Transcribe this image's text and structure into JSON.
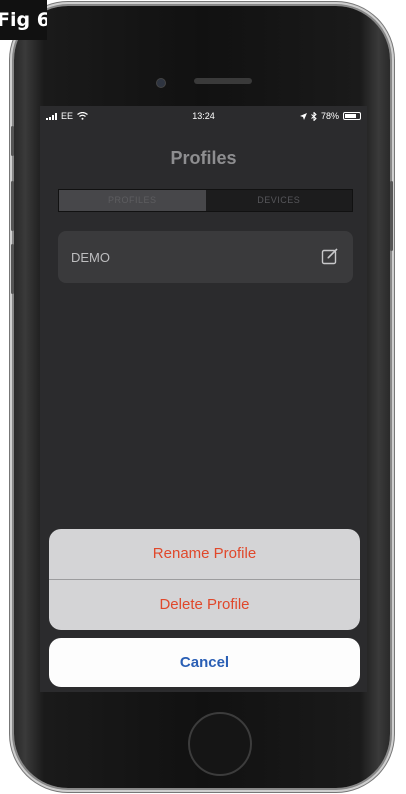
{
  "figure_label": "Fig 6",
  "status_bar": {
    "carrier": "EE",
    "time": "13:24",
    "battery": "78%"
  },
  "header": {
    "title": "Profiles"
  },
  "tabs": [
    {
      "label": "PROFILES",
      "selected": true
    },
    {
      "label": "DEVICES",
      "selected": false
    }
  ],
  "profiles": [
    {
      "name": "DEMO",
      "icon": "edit-icon"
    }
  ],
  "action_sheet": {
    "rename_label": "Rename Profile",
    "delete_label": "Delete Profile",
    "cancel_label": "Cancel"
  },
  "colors": {
    "destructive": "#e0482b",
    "cancel": "#2a5fb5",
    "background": "#2b2b2d"
  }
}
